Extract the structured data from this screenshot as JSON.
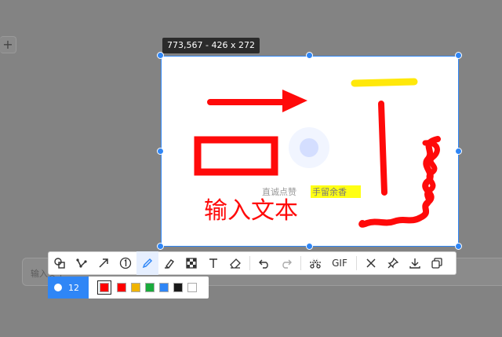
{
  "background": {
    "input_placeholder": "输入文字",
    "plus_label": "+"
  },
  "selection": {
    "info": "773,567 - 426 x 272"
  },
  "canvas": {
    "watermark": "直诚点赞",
    "highlight_text": "手留余香",
    "typed_text": "输入文本"
  },
  "toolbar": {
    "gif_label": "GIF",
    "tools": [
      "shape",
      "polyline",
      "arrow",
      "number-step",
      "pen",
      "marker",
      "mosaic",
      "text",
      "eraser",
      "undo",
      "redo",
      "cutout",
      "gif",
      "close",
      "pin",
      "download",
      "copy"
    ]
  },
  "subbar": {
    "brush_size": "12",
    "colors": [
      "#ff0000",
      "#ff0000",
      "#f0b400",
      "#1aab3c",
      "#2f86f6",
      "#1a1a1a",
      "#ffffff"
    ],
    "selected_color_index": 0
  }
}
